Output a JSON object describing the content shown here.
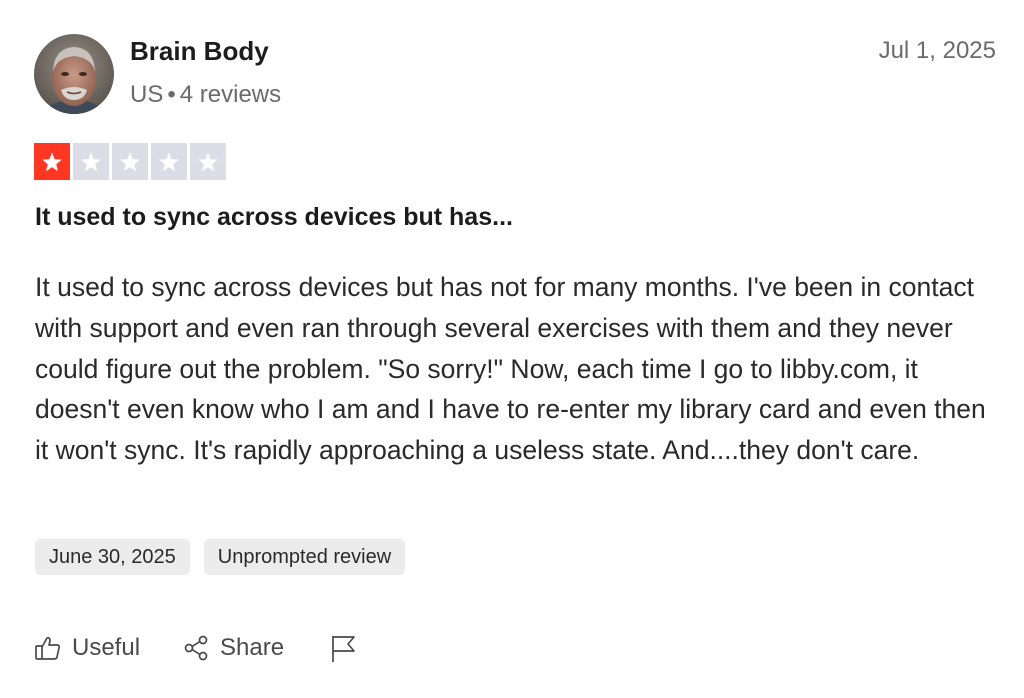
{
  "reviewer": {
    "name": "Brain Body",
    "country": "US",
    "separator": "•",
    "reviews_count": "4 reviews",
    "avatar_icon": "user-photo"
  },
  "review": {
    "date": "Jul 1, 2025",
    "rating": 1,
    "rating_max": 5,
    "rating_color": "#ff3722",
    "rating_empty_color": "#dcdce6",
    "title": "It used to sync across devices but has...",
    "body": "It used to sync across devices but has not for many months. I've been in contact with support and even ran through several exercises with them and they never could figure out the problem. \"So sorry!\" Now, each time I go to libby.com, it doesn't even know who I am and I have to re-enter my library card and even then it won't sync. It's rapidly approaching a useless state. And....they don't care.",
    "tags": [
      "June 30, 2025",
      "Unprompted review"
    ]
  },
  "actions": {
    "useful_label": "Useful",
    "useful_icon": "thumbs-up-icon",
    "share_label": "Share",
    "share_icon": "share-icon",
    "report_icon": "flag-icon"
  }
}
